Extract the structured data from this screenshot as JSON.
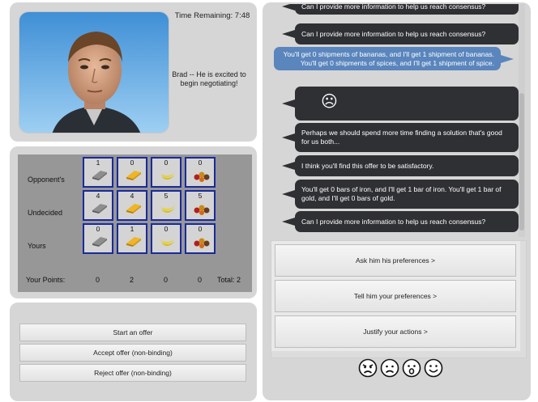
{
  "agent": {
    "time_label": "Time Remaining: 7:48",
    "status": "Brad -- He is excited to begin negotiating!"
  },
  "board": {
    "row_labels": [
      "Opponent's",
      "Undecided",
      "Yours"
    ],
    "items": [
      "iron",
      "gold",
      "bananas",
      "spices"
    ],
    "rows": {
      "opponent": [
        1,
        0,
        0,
        0
      ],
      "undecided": [
        4,
        4,
        5,
        5
      ],
      "yours": [
        0,
        1,
        0,
        0
      ]
    },
    "points_label": "Your Points:",
    "points": [
      "0",
      "2",
      "0",
      "0"
    ],
    "total": "Total: 2"
  },
  "actions": {
    "start": "Start an offer",
    "accept": "Accept offer (non-binding)",
    "reject": "Reject offer (non-binding)"
  },
  "chat": {
    "messages": [
      {
        "from": "agent",
        "text": "Can I provide more information to help us reach consensus?"
      },
      {
        "from": "agent",
        "text": "Can I provide more information to help us reach consensus?"
      },
      {
        "from": "user",
        "text": "You'll get 0 shipments of bananas, and I'll get 1 shipment of bananas. You'll get 0 shipments of spices, and I'll get 1 shipment of spice."
      },
      {
        "from": "agent",
        "text": "☹"
      },
      {
        "from": "agent",
        "text": "Perhaps we should spend more time finding a solution that's good for us both..."
      },
      {
        "from": "agent",
        "text": "I think you'll find this offer to be satisfactory."
      },
      {
        "from": "agent",
        "text": "You'll get 0 bars of iron, and I'll get 1 bar of iron. You'll get 1 bar of gold, and I'll get 0 bars of gold."
      },
      {
        "from": "agent",
        "text": "Can I provide more information to help us reach consensus?"
      }
    ]
  },
  "prefs": {
    "ask": "Ask him his preferences >",
    "tell": "Tell him your preferences >",
    "justify": "Justify your actions >"
  },
  "emojis": [
    "angry-face-icon",
    "sad-face-icon",
    "surprised-face-icon",
    "happy-face-icon"
  ]
}
